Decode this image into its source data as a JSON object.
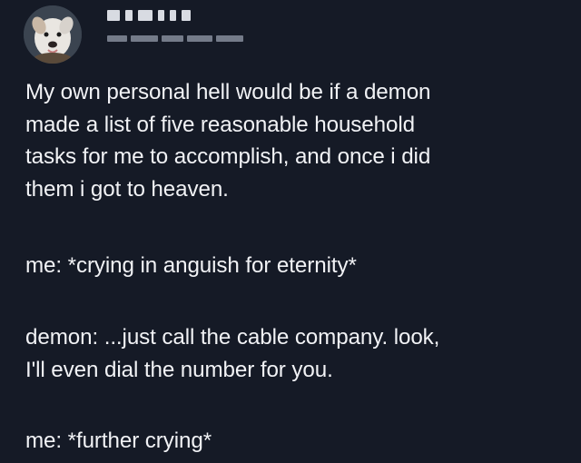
{
  "post": {
    "paragraphs": [
      [
        "My own personal hell would be if a demon",
        "made a list of five reasonable household",
        "tasks for me to accomplish, and once i did",
        "them i got to heaven."
      ],
      [
        "me: *crying in anguish for eternity*"
      ],
      [
        "demon: ...just call the cable company. look,",
        "I'll even dial the number for you."
      ],
      [
        "me: *further crying*"
      ]
    ]
  },
  "colors": {
    "background": "#151a26",
    "text": "#f1f2f5"
  },
  "icons": {
    "avatar": "dog-avatar-icon"
  }
}
